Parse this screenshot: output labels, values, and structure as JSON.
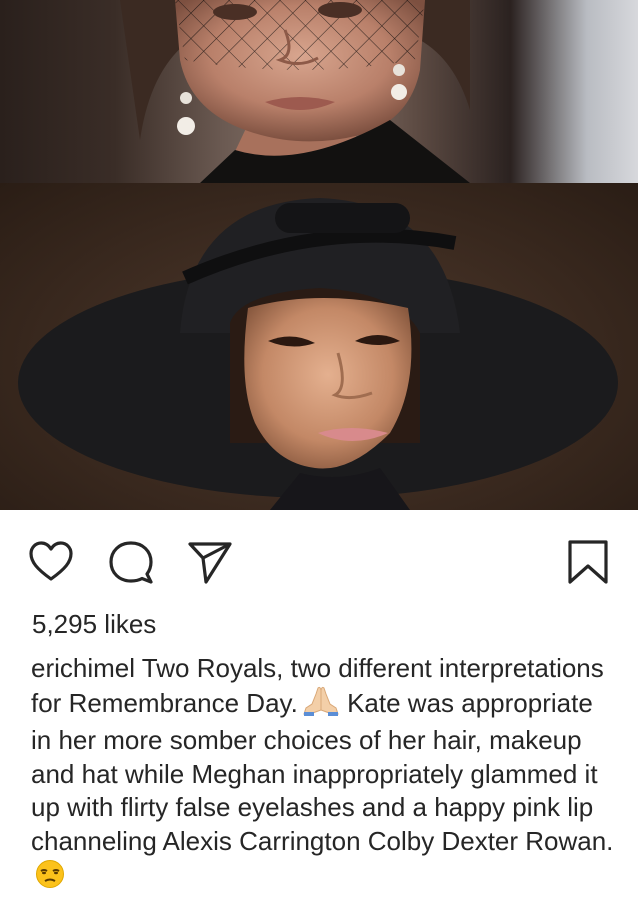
{
  "post": {
    "likes_text": "5,295 likes",
    "username": "erichimel",
    "caption_text": "Two Royals, two different interpretations for Remembrance Day.",
    "caption_text_2": "Kate was appropriate in her more somber choices of her hair, makeup and hat while Meghan inappropriately glammed it up with flirty false eyelashes and a happy pink lip channeling Alexis Carrington Colby Dexter Rowan.",
    "emoji_1": "praying-hands-emoji",
    "emoji_2": "unamused-face-emoji"
  },
  "actions": {
    "like": "heart-icon",
    "comment": "comment-bubble-icon",
    "share": "paper-plane-icon",
    "save": "bookmark-icon"
  },
  "colors": {
    "text": "#262626",
    "background": "#ffffff"
  }
}
